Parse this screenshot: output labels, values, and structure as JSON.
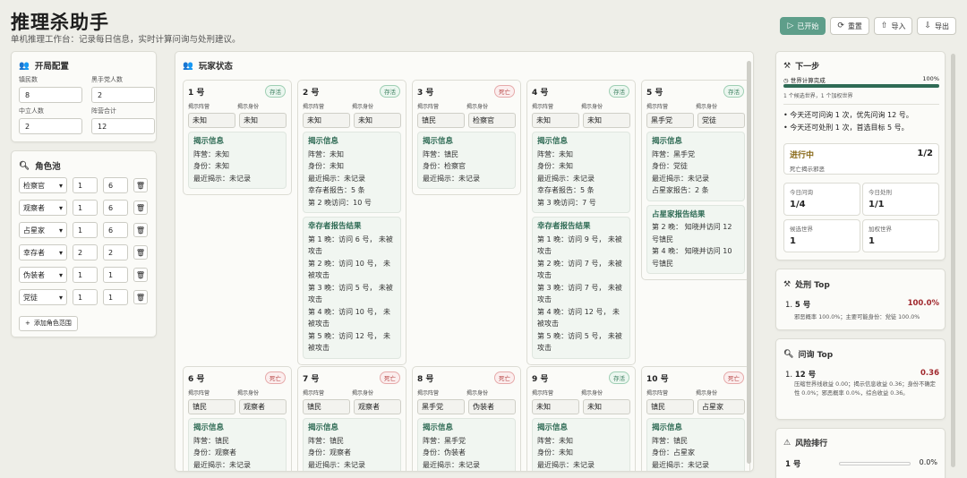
{
  "app": {
    "title": "推理杀助手",
    "subtitle": "单机推理工作台：记录每日信息，实时计算问询与处刑建议。"
  },
  "toolbar": {
    "start": "已开始",
    "reset": "重置",
    "import": "导入",
    "export": "导出"
  },
  "config": {
    "title": "开局配置",
    "fields": [
      {
        "label": "镇民数",
        "value": "8"
      },
      {
        "label": "黑手党人数",
        "value": "2"
      },
      {
        "label": "中立人数",
        "value": "2"
      },
      {
        "label": "阵营合计",
        "value": "12"
      }
    ]
  },
  "roles": {
    "title": "角色池",
    "items": [
      {
        "name": "检察官",
        "min": "1",
        "max": "6"
      },
      {
        "name": "观察者",
        "min": "1",
        "max": "6"
      },
      {
        "name": "占星家",
        "min": "1",
        "max": "6"
      },
      {
        "name": "幸存者",
        "min": "2",
        "max": "2"
      },
      {
        "name": "伪装者",
        "min": "1",
        "max": "1"
      },
      {
        "name": "党徒",
        "min": "1",
        "max": "1"
      }
    ],
    "add_label": "添加角色范围"
  },
  "players_panel": {
    "title": "玩家状态",
    "camp_label": "揭示阵营",
    "identity_label": "揭示身份",
    "reveal_title": "揭示信息",
    "players": [
      {
        "num": "1 号",
        "status": "存活",
        "alive": true,
        "camp": "未知",
        "identity": "未知",
        "reveal": [
          "阵营：未知",
          "身份：未知",
          "最近揭示：未记录"
        ],
        "extra": null
      },
      {
        "num": "2 号",
        "status": "存活",
        "alive": true,
        "camp": "未知",
        "identity": "未知",
        "reveal": [
          "阵营：未知",
          "身份：未知",
          "最近揭示：未记录",
          "幸存者报告：5 条",
          "第 2 晚访问：10 号"
        ],
        "extra": {
          "title": "幸存者报告结果",
          "lines": [
            "第 1 晚：访问 6 号， 未被攻击",
            "第 2 晚：访问 10 号， 未被攻击",
            "第 3 晚：访问 5 号， 未被攻击",
            "第 4 晚：访问 10 号， 未被攻击",
            "第 5 晚：访问 12 号， 未被攻击"
          ]
        }
      },
      {
        "num": "3 号",
        "status": "死亡",
        "alive": false,
        "camp": "镇民",
        "identity": "检察官",
        "reveal": [
          "阵营：镇民",
          "身份：检察官",
          "最近揭示：未记录"
        ],
        "extra": null
      },
      {
        "num": "4 号",
        "status": "存活",
        "alive": true,
        "camp": "未知",
        "identity": "未知",
        "reveal": [
          "阵营：未知",
          "身份：未知",
          "最近揭示：未记录",
          "幸存者报告：5 条",
          "第 3 晚访问：7 号"
        ],
        "extra": {
          "title": "幸存者报告结果",
          "lines": [
            "第 1 晚：访问 9 号， 未被攻击",
            "第 2 晚：访问 7 号， 未被攻击",
            "第 3 晚：访问 7 号， 未被攻击",
            "第 4 晚：访问 12 号， 未被攻击",
            "第 5 晚：访问 5 号， 未被攻击"
          ]
        }
      },
      {
        "num": "5 号",
        "status": "存活",
        "alive": true,
        "camp": "黑手党",
        "identity": "党徒",
        "reveal": [
          "阵营：黑手党",
          "身份：党徒",
          "最近揭示：未记录",
          "占星家报告：2 条"
        ],
        "extra": {
          "title": "占星家报告结果",
          "lines": [
            "第 2 晚： 知晓并访问 12 号镇民",
            "第 4 晚： 知晓并访问 10 号镇民"
          ]
        }
      },
      {
        "num": "6 号",
        "status": "死亡",
        "alive": false,
        "camp": "镇民",
        "identity": "观察者",
        "reveal": [
          "阵营：镇民",
          "身份：观察者",
          "最近揭示：未记录"
        ],
        "extra": null
      },
      {
        "num": "7 号",
        "status": "死亡",
        "alive": false,
        "camp": "镇民",
        "identity": "观察者",
        "reveal": [
          "阵营：镇民",
          "身份：观察者",
          "最近揭示：未记录"
        ],
        "extra": null
      },
      {
        "num": "8 号",
        "status": "死亡",
        "alive": false,
        "camp": "黑手党",
        "identity": "伪装者",
        "reveal": [
          "阵营：黑手党",
          "身份：伪装者",
          "最近揭示：未记录"
        ],
        "extra": null
      },
      {
        "num": "9 号",
        "status": "存活",
        "alive": true,
        "camp": "未知",
        "identity": "未知",
        "reveal": [
          "阵营：未知",
          "身份：未知",
          "最近揭示：未记录"
        ],
        "extra": null
      },
      {
        "num": "10 号",
        "status": "死亡",
        "alive": false,
        "camp": "镇民",
        "identity": "占星家",
        "reveal": [
          "阵营：镇民",
          "身份：占星家",
          "最近揭示：未记录"
        ],
        "extra": null
      }
    ]
  },
  "next_step": {
    "title": "下一步",
    "progress_label": "世界计算完成",
    "progress_pct": "100%",
    "progress_value": 1.0,
    "progress_note": "1 个候选世界，1 个加权世界",
    "bullets": [
      "今天还可问询 1 次，优先问询 12 号。",
      "今天还可处刑 1 次，首选目标 5 号。"
    ],
    "phase_title": "进行中",
    "phase_value": "1/2",
    "phase_note": "死亡揭示邪恶",
    "tiles": [
      {
        "label": "今日问询",
        "value": "1/4"
      },
      {
        "label": "今日处刑",
        "value": "1/1"
      },
      {
        "label": "候选世界",
        "value": "1"
      },
      {
        "label": "加权世界",
        "value": "1"
      }
    ]
  },
  "exec_top": {
    "title": "处刑 Top",
    "rank": "1.",
    "name": "5 号",
    "value": "100.0%",
    "detail": "邪恶概率 100.0%；主要可能身份：党徒 100.0%"
  },
  "ask_top": {
    "title": "问询 Top",
    "rank": "1.",
    "name": "12 号",
    "value": "0.36",
    "detail": "压缩世界线收益 0.00；揭示信息收益 0.36；身份不确定性 0.0%；邪恶概率 0.0%，综合收益 0.36。"
  },
  "risk": {
    "title": "风险排行",
    "first_name": "1 号",
    "first_value": "0.0%"
  }
}
